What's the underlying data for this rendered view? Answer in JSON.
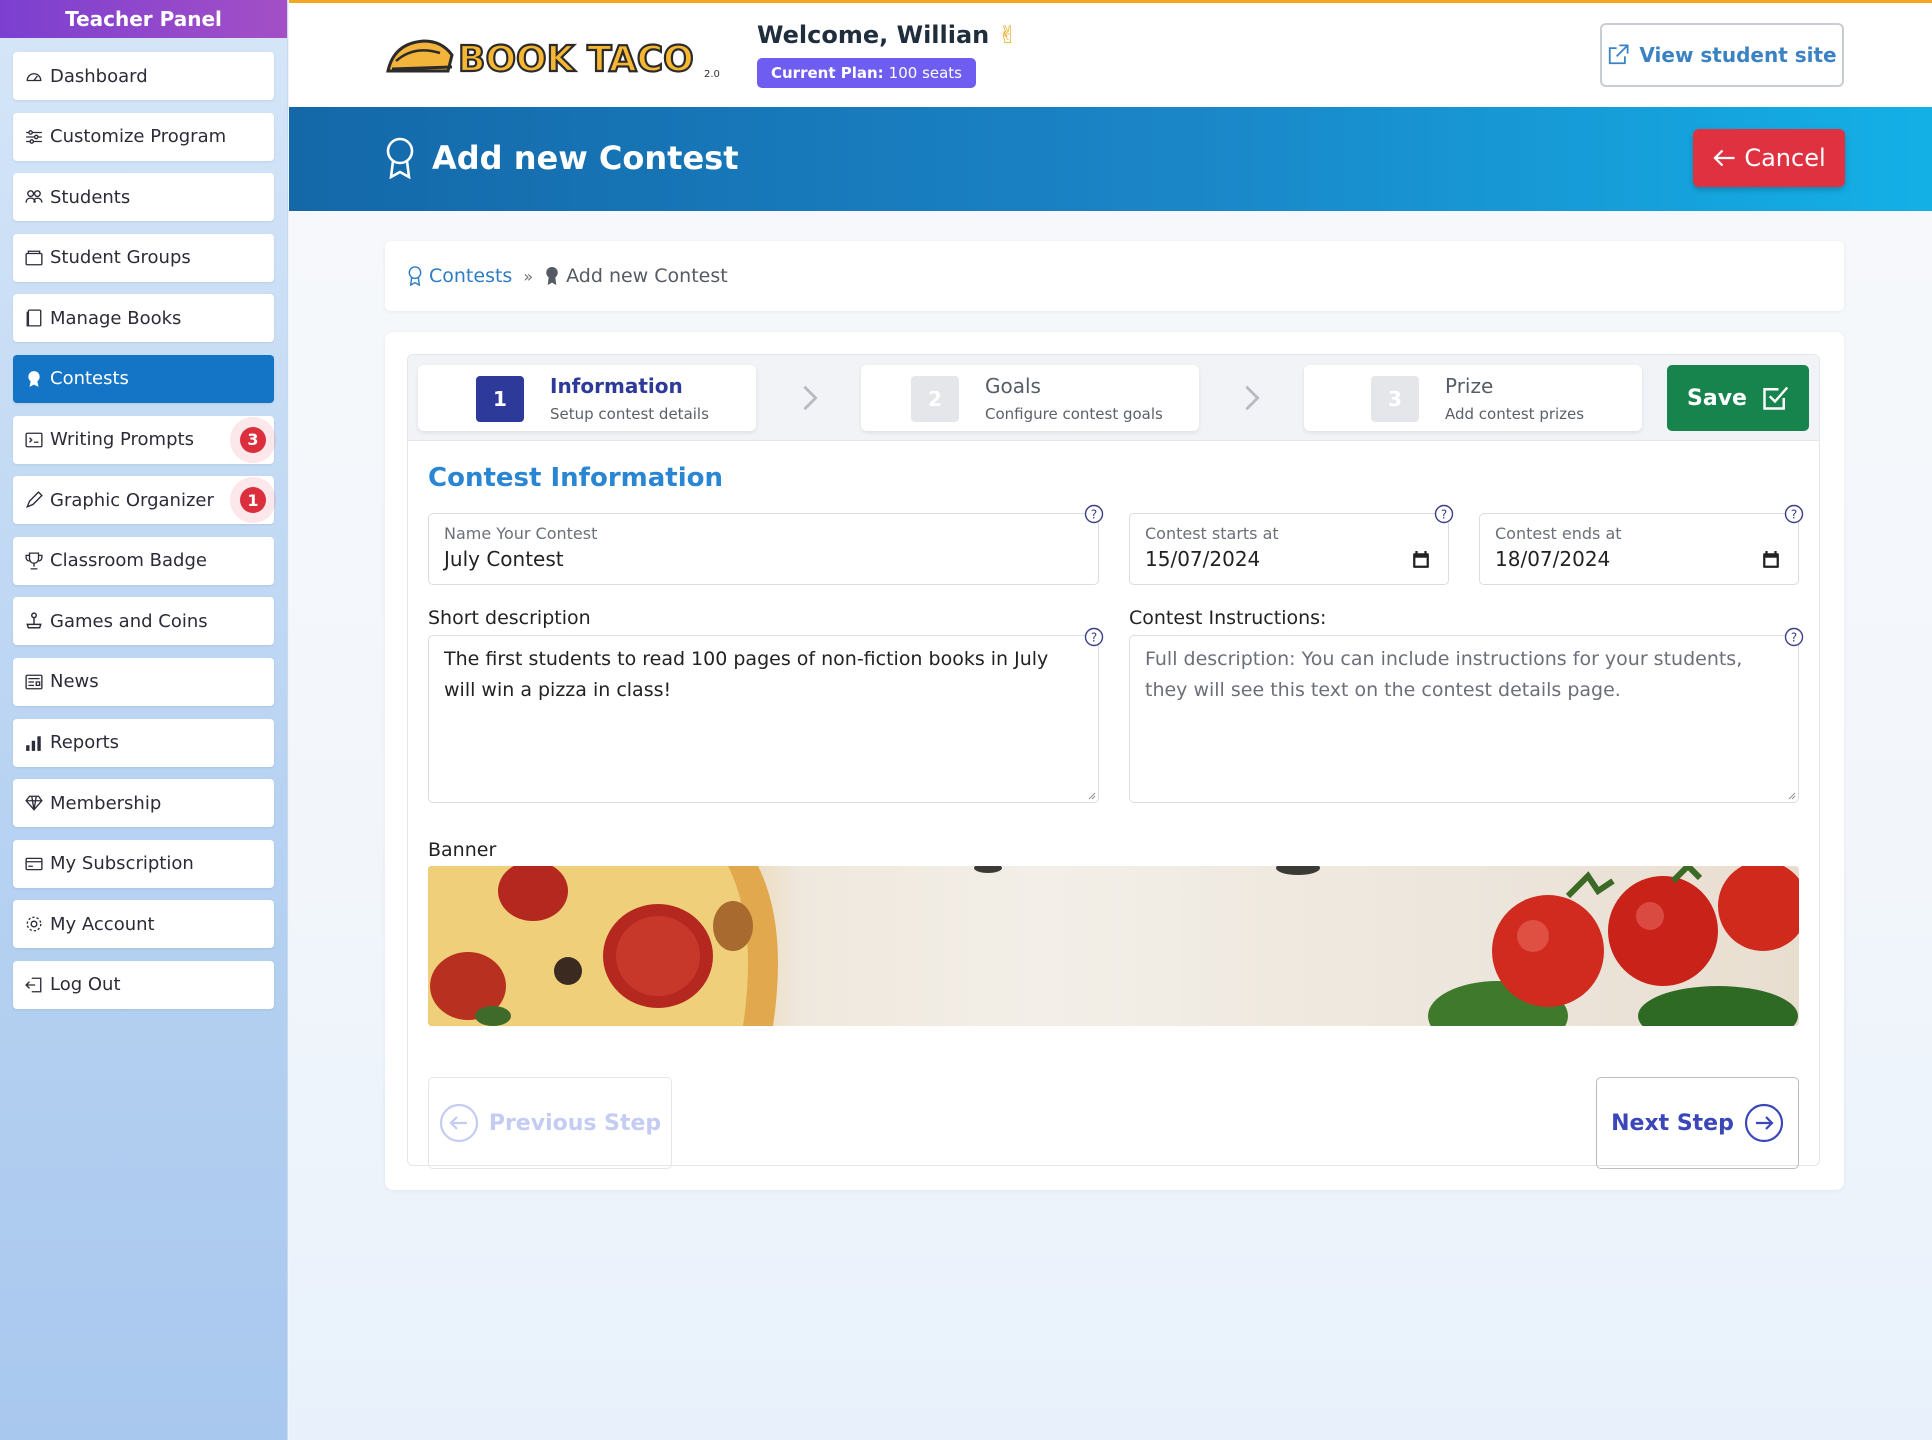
{
  "sidebar": {
    "title": "Teacher Panel",
    "items": [
      {
        "label": "Dashboard",
        "icon": "gauge-icon"
      },
      {
        "label": "Customize Program",
        "icon": "sliders-icon"
      },
      {
        "label": "Students",
        "icon": "people-icon"
      },
      {
        "label": "Student Groups",
        "icon": "folder-icon"
      },
      {
        "label": "Manage Books",
        "icon": "book-icon"
      },
      {
        "label": "Contests",
        "icon": "award-icon",
        "active": true
      },
      {
        "label": "Writing Prompts",
        "icon": "terminal-icon",
        "badge": "3"
      },
      {
        "label": "Graphic Organizer",
        "icon": "pencil-icon",
        "badge": "1"
      },
      {
        "label": "Classroom Badge",
        "icon": "trophy-icon"
      },
      {
        "label": "Games and Coins",
        "icon": "joystick-icon"
      },
      {
        "label": "News",
        "icon": "newspaper-icon"
      },
      {
        "label": "Reports",
        "icon": "bar-chart-icon"
      },
      {
        "label": "Membership",
        "icon": "gem-icon"
      },
      {
        "label": "My Subscription",
        "icon": "credit-card-icon"
      },
      {
        "label": "My Account",
        "icon": "gear-icon"
      },
      {
        "label": "Log Out",
        "icon": "logout-icon"
      }
    ]
  },
  "header": {
    "logo_text": "BOOK TACO",
    "logo_version": "2.0",
    "welcome": "Welcome, Willian",
    "welcome_emoji": "✌",
    "plan_label": "Current Plan:",
    "plan_value": "100 seats",
    "view_site": "View student site"
  },
  "hero": {
    "title": "Add new Contest",
    "cancel": "Cancel"
  },
  "breadcrumb": {
    "parent": "Contests",
    "separator": "»",
    "current": "Add new Contest"
  },
  "steps": [
    {
      "num": "1",
      "title": "Information",
      "subtitle": "Setup contest details",
      "active": true
    },
    {
      "num": "2",
      "title": "Goals",
      "subtitle": "Configure contest goals"
    },
    {
      "num": "3",
      "title": "Prize",
      "subtitle": "Add contest prizes"
    }
  ],
  "save": "Save",
  "form": {
    "section_title": "Contest Information",
    "name_label": "Name Your Contest",
    "name_value": "July Contest",
    "start_label": "Contest starts at",
    "start_value": "15/07/2024",
    "end_label": "Contest ends at",
    "end_value": "18/07/2024",
    "short_desc_label": "Short description",
    "short_desc_value": "The first students to read 100 pages of non-fiction books in July will win a pizza in class!",
    "instructions_label": "Contest Instructions:",
    "instructions_placeholder": "Full description: You can include instructions for your students, they will see this text on the contest details page.",
    "banner_label": "Banner"
  },
  "nav": {
    "previous": "Previous Step",
    "next": "Next Step"
  },
  "colors": {
    "accent": "#1474c6",
    "save": "#17844d",
    "cancel": "#e03140",
    "plan": "#6e5df0",
    "step_active": "#2d3a9a"
  }
}
